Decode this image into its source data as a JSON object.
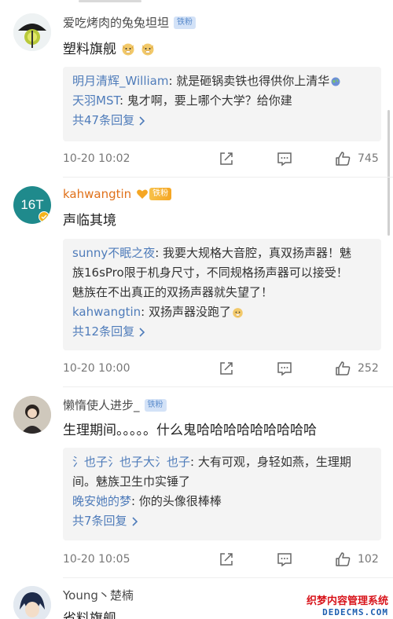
{
  "comments": [
    {
      "username": "爱吃烤肉的兔兔坦坦",
      "badge": "铁粉",
      "content": "塑料旗舰",
      "replies": [
        {
          "name": "明月清辉_William",
          "text": ": 就是砸锅卖铁也得供你上清华"
        },
        {
          "name": "天羽MST",
          "text": ": 鬼才啊，要上哪个大学？给你建"
        }
      ],
      "more": "共47条回复",
      "time": "10-20 10:02",
      "likes": "745"
    },
    {
      "username": "kahwangtin",
      "badge": "铁粉",
      "avatar_text": "16T",
      "content": "声临其境",
      "replies": [
        {
          "name": "sunny不眠之夜",
          "text": ": 我要大规格大音腔，真双扬声器！魅"
        },
        {
          "name": "",
          "text": "族16sPro限于机身尺寸，不同规格扬声器可以接受！"
        },
        {
          "name": "",
          "text": "魅族在不出真正的双扬声器就失望了！"
        },
        {
          "name": "kahwangtin",
          "text": ": 双扬声器没跑了"
        }
      ],
      "more": "共12条回复",
      "time": "10-20 10:00",
      "likes": "252"
    },
    {
      "username": "懒惰使人进步_",
      "badge": "铁粉",
      "content": "生理期间。。。。。什么鬼哈哈哈哈哈哈哈哈哈",
      "replies": [
        {
          "name": "氵也子氵也子大氵也子",
          "text": ": 大有可观，身轻如燕，生理期"
        },
        {
          "name": "",
          "text": "间。魅族卫生巾实锤了"
        },
        {
          "name": "晚安她的梦",
          "text": ": 你的头像很棒棒"
        }
      ],
      "more": "共7条回复",
      "time": "10-20 10:05",
      "likes": "102"
    },
    {
      "username": "Young丶楚楠",
      "content": "省料旗舰"
    }
  ],
  "watermark": {
    "line1": "织梦内容管理系统",
    "line2": "DEDECMS.COM"
  },
  "colors": {
    "link": "#4f7cba",
    "orange_name": "#e0711a",
    "reply_bg": "#f4f4f4"
  }
}
